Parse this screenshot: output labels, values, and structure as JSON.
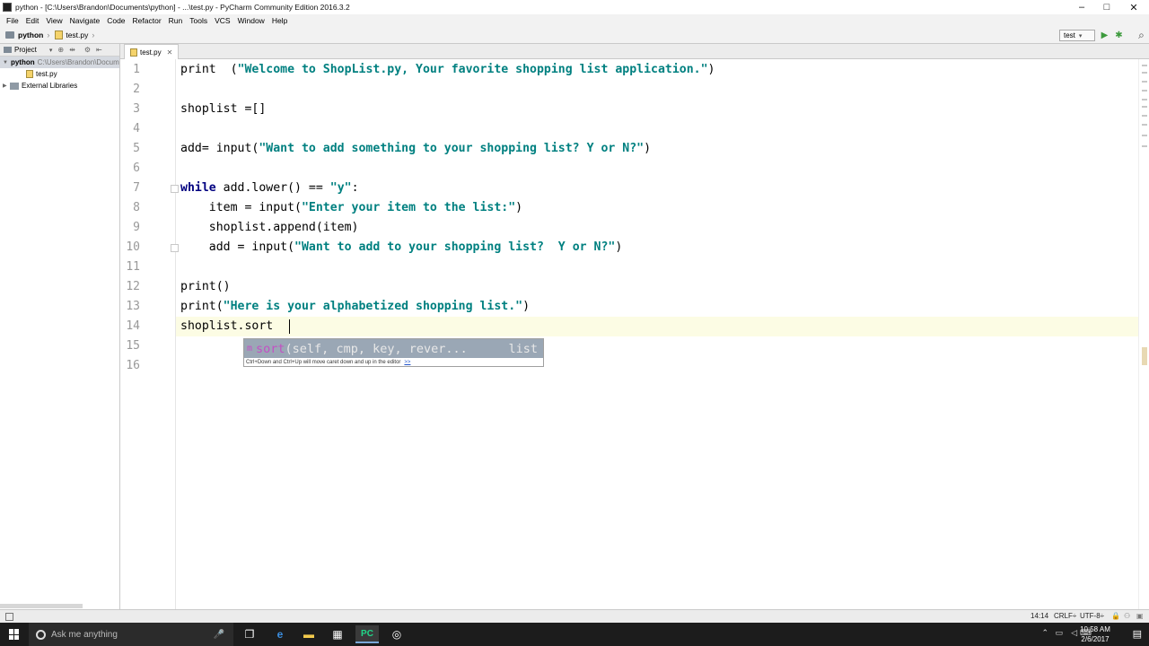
{
  "window": {
    "title": "python - [C:\\Users\\Brandon\\Documents\\python] - ...\\test.py - PyCharm Community Edition 2016.3.2",
    "minimize": "–",
    "maximize": "□",
    "close": "✕"
  },
  "menu": [
    "File",
    "Edit",
    "View",
    "Navigate",
    "Code",
    "Refactor",
    "Run",
    "Tools",
    "VCS",
    "Window",
    "Help"
  ],
  "navbar": {
    "project_crumb": "python",
    "file_crumb": "test.py",
    "run_config": "test",
    "run_config_arrow": "▾",
    "run_icon": "▶",
    "debug_icon": "✱",
    "search_icon": "⌕"
  },
  "project_panel": {
    "header": "Project",
    "header_arrow": "▾",
    "root_name": "python",
    "root_path": "C:\\Users\\Brandon\\Documents\\python",
    "file": "test.py",
    "libraries": "External Libraries"
  },
  "editor": {
    "tab_label": "test.py",
    "tab_close": "✕",
    "line_numbers": [
      "1",
      "2",
      "3",
      "4",
      "5",
      "6",
      "7",
      "8",
      "9",
      "10",
      "11",
      "12",
      "13",
      "14",
      "15",
      "16"
    ],
    "completion": {
      "marker": "m",
      "name": "sort",
      "signature": "(self, cmp, key, rever...",
      "type": "list",
      "hint": "Ctrl+Down and Ctrl+Up will move caret down and up in the editor",
      "hint_link": ">>"
    }
  },
  "status": {
    "position": "14:14",
    "line_sep": "CRLF÷",
    "encoding": "UTF-8÷"
  },
  "taskbar": {
    "search_placeholder": "Ask me anything",
    "time": "10:58 AM",
    "date": "2/6/2017"
  }
}
